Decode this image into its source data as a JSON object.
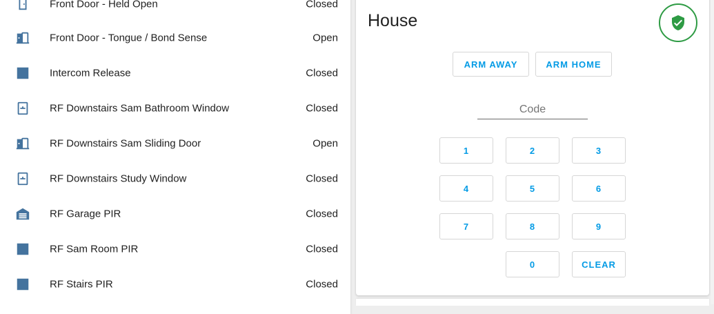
{
  "entities": [
    {
      "name": "Front Door - Held Open",
      "state": "Closed",
      "icon": "door-closed-icon"
    },
    {
      "name": "Front Door - Tongue / Bond Sense",
      "state": "Open",
      "icon": "door-open-icon"
    },
    {
      "name": "Intercom Release",
      "state": "Closed",
      "icon": "square-icon"
    },
    {
      "name": "RF Downstairs Sam Bathroom Window",
      "state": "Closed",
      "icon": "window-closed-icon"
    },
    {
      "name": "RF Downstairs Sam Sliding Door",
      "state": "Open",
      "icon": "door-open-icon"
    },
    {
      "name": "RF Downstairs Study Window",
      "state": "Closed",
      "icon": "window-closed-icon"
    },
    {
      "name": "RF Garage PIR",
      "state": "Closed",
      "icon": "garage-icon"
    },
    {
      "name": "RF Sam Room PIR",
      "state": "Closed",
      "icon": "square-icon"
    },
    {
      "name": "RF Stairs PIR",
      "state": "Closed",
      "icon": "square-icon"
    }
  ],
  "alarm": {
    "title": "House",
    "status_icon": "shield-check-icon",
    "arm_away": "ARM AWAY",
    "arm_home": "ARM HOME",
    "code_label": "Code",
    "keys": [
      "1",
      "2",
      "3",
      "4",
      "5",
      "6",
      "7",
      "8",
      "9",
      "0"
    ],
    "clear": "CLEAR"
  },
  "colors": {
    "icon": "#44739e",
    "accent": "#039be5",
    "armed_green": "#2e9b44"
  }
}
